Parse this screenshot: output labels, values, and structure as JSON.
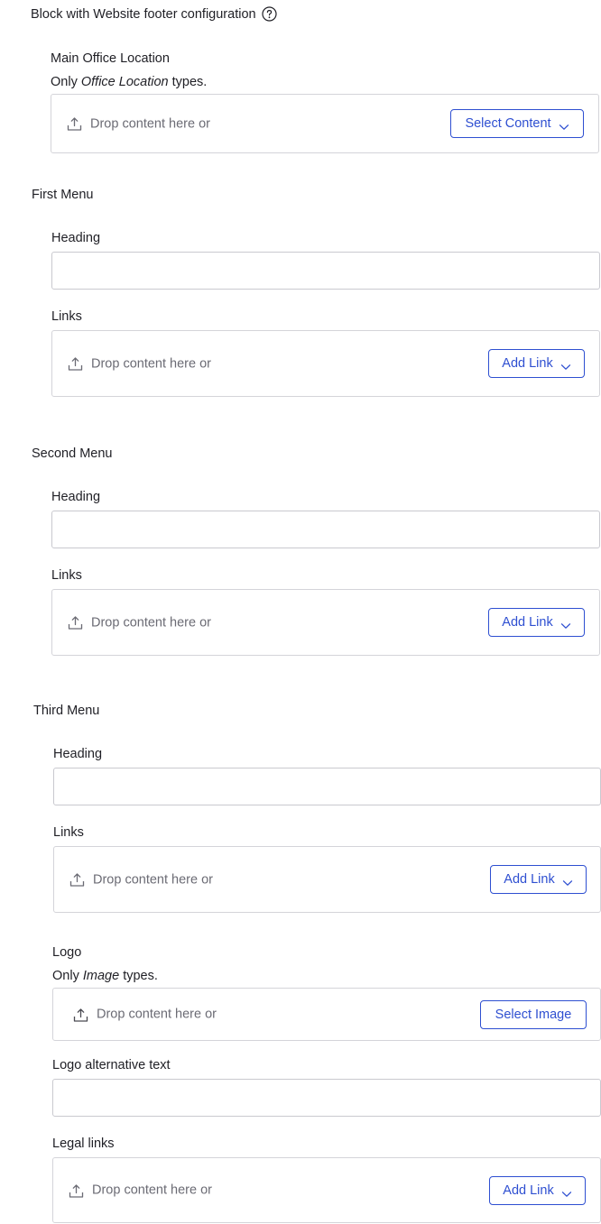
{
  "block": {
    "title": "Block with Website footer configuration"
  },
  "main_office": {
    "label": "Main Office Location",
    "hint_prefix": "Only",
    "hint_type": "Office Location",
    "hint_suffix": "types.",
    "drop_text": "Drop content here or",
    "button_label": "Select Content"
  },
  "first_menu": {
    "label": "First Menu",
    "heading_label": "Heading",
    "heading_value": "",
    "links_label": "Links",
    "drop_text": "Drop content here or",
    "button_label": "Add Link"
  },
  "second_menu": {
    "label": "Second Menu",
    "heading_label": "Heading",
    "heading_value": "",
    "links_label": "Links",
    "drop_text": "Drop content here or",
    "button_label": "Add Link"
  },
  "third_menu": {
    "label": "Third Menu",
    "heading_label": "Heading",
    "heading_value": "",
    "links_label": "Links",
    "drop_text": "Drop content here or",
    "button_label": "Add Link"
  },
  "logo": {
    "label": "Logo",
    "hint_prefix": "Only",
    "hint_type": "Image",
    "hint_suffix": "types.",
    "drop_text": "Drop content here or",
    "button_label": "Select Image"
  },
  "logo_alt": {
    "label": "Logo alternative text",
    "value": ""
  },
  "legal_links": {
    "label": "Legal links",
    "drop_text": "Drop content here or",
    "button_label": "Add Link"
  },
  "colors": {
    "accent": "#2e4fd1",
    "border": "#d4d4d9",
    "muted_text": "#6b6b74"
  }
}
